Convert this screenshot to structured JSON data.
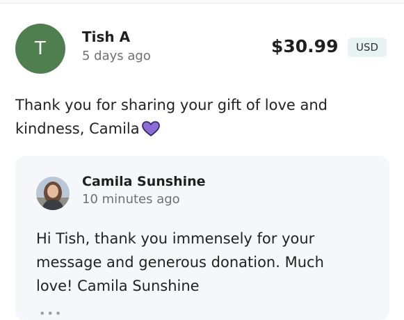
{
  "donation": {
    "avatar_initial": "T",
    "donor_name": "Tish A",
    "time_ago": "5 days ago",
    "amount": "$30.99",
    "currency": "USD",
    "message": "Thank you for sharing your gift of love and kindness, Camila",
    "heart_icon": "purple-heart-icon"
  },
  "reply": {
    "author_name": "Camila Sunshine",
    "time_ago": "10 minutes ago",
    "message": "Hi Tish, thank you immensely for your message and generous donation. Much love! Camila Sunshine",
    "more_icon": "more-dots-icon"
  },
  "colors": {
    "donor_avatar_bg": "#4f7f4f",
    "currency_badge_bg": "#e7f3f3",
    "reply_card_bg": "#f6f7fa",
    "heart": "#8b6bd9"
  }
}
